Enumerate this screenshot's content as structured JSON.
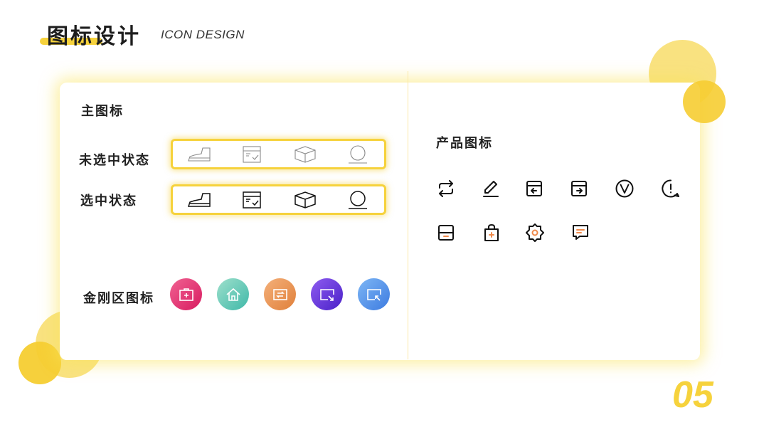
{
  "header": {
    "title_cn": "图标设计",
    "title_en": "ICON DESIGN"
  },
  "left": {
    "main_icons_label": "主图标",
    "unselected_label": "未选中状态",
    "selected_label": "选中状态",
    "kingkong_label": "金刚区图标",
    "state_icons": [
      "shoe-icon",
      "delivery-box-icon",
      "package-icon",
      "user-profile-icon"
    ],
    "kingkong_icons": [
      {
        "name": "medical-kit-icon",
        "colors": [
          "#f06292",
          "#d81b60"
        ]
      },
      {
        "name": "home-icon",
        "colors": [
          "#9ee0cc",
          "#3fb8a8"
        ]
      },
      {
        "name": "exchange-icon",
        "colors": [
          "#f4b07a",
          "#e0803a"
        ]
      },
      {
        "name": "screen-share-icon",
        "colors": [
          "#8e5cf0",
          "#4a21c8"
        ]
      },
      {
        "name": "screen-return-icon",
        "colors": [
          "#7db6f5",
          "#3d7be0"
        ]
      }
    ]
  },
  "right": {
    "product_icons_label": "产品图标",
    "icons": [
      "repeat-icon",
      "edit-icon",
      "box-in-icon",
      "box-out-icon",
      "verify-icon",
      "alert-bubble-icon",
      "archive-icon",
      "shopping-bag-icon",
      "settings-icon",
      "message-icon"
    ],
    "accent_color": "#f08a4b"
  },
  "footer": {
    "page_number": "05"
  },
  "colors": {
    "accent": "#f6d23c"
  }
}
